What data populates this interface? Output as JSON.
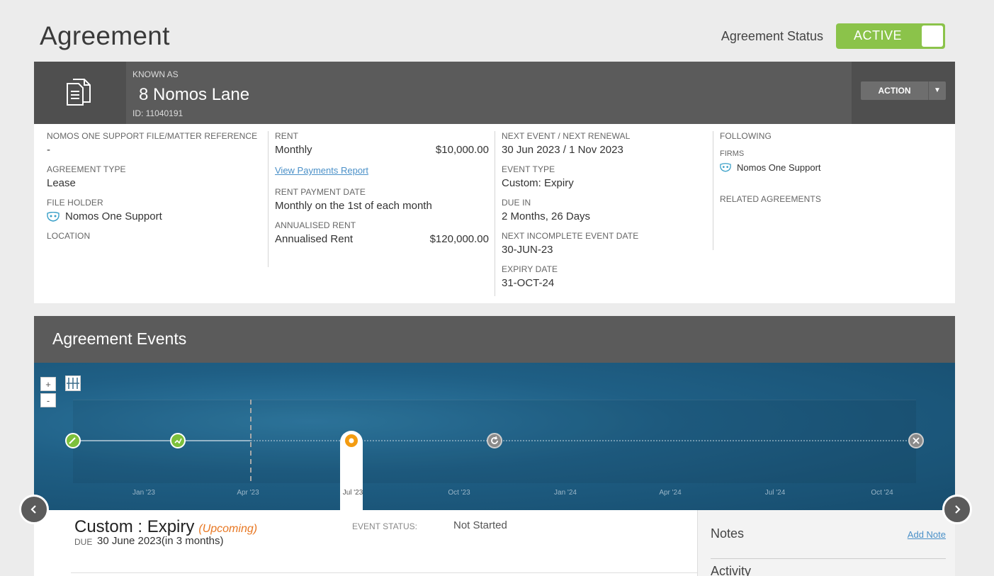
{
  "page": {
    "title": "Agreement",
    "status_label": "Agreement Status",
    "status_value": "ACTIVE",
    "status_color": "#8bc34a"
  },
  "header": {
    "known_as_label": "KNOWN AS",
    "name": "8 Nomos Lane",
    "id_text": "ID: 11040191",
    "action_label": "ACTION",
    "icon": "document-icon"
  },
  "details": {
    "file_ref_label": "NOMOS ONE SUPPORT FILE/MATTER REFERENCE",
    "file_ref_value": "-",
    "agreement_type_label": "AGREEMENT TYPE",
    "agreement_type_value": "Lease",
    "file_holder_label": "FILE HOLDER",
    "file_holder_value": "Nomos One Support",
    "location_label": "LOCATION",
    "rent_label": "RENT",
    "rent_frequency": "Monthly",
    "rent_amount": "$10,000.00",
    "payments_link": "View Payments Report",
    "rent_payment_date_label": "RENT PAYMENT DATE",
    "rent_payment_date_value": "Monthly on the 1st of each month",
    "annualised_label": "ANNUALISED RENT",
    "annualised_name": "Annualised Rent",
    "annualised_amount": "$120,000.00",
    "next_event_label": "NEXT EVENT / NEXT RENEWAL",
    "next_event_value": "30 Jun 2023 / 1 Nov 2023",
    "event_type_label": "EVENT TYPE",
    "event_type_value": "Custom: Expiry",
    "due_in_label": "DUE IN",
    "due_in_value": "2 Months, 26 Days",
    "next_incomplete_label": "NEXT INCOMPLETE EVENT DATE",
    "next_incomplete_value": "30-JUN-23",
    "expiry_label": "EXPIRY DATE",
    "expiry_value": "31-OCT-24",
    "following_label": "FOLLOWING",
    "firms_label": "FIRMS",
    "firm_value": "Nomos One Support",
    "related_label": "RELATED AGREEMENTS"
  },
  "events": {
    "title": "Agreement Events",
    "zoom_in": "+",
    "zoom_out": "-",
    "axis_labels": [
      "Jan '23",
      "Apr '23",
      "Jul '23",
      "Oct '23",
      "Jan '24",
      "Apr '24",
      "Jul '24",
      "Oct '24"
    ],
    "detail": {
      "title": "Custom : Expiry",
      "tag": "(Upcoming)",
      "due_label": "DUE",
      "due_value": "30 June 2023(in 3 months)",
      "status_label": "EVENT STATUS:",
      "status_value": "Not Started"
    },
    "notes_title": "Notes",
    "add_note": "Add Note",
    "activity_title": "Activity"
  }
}
